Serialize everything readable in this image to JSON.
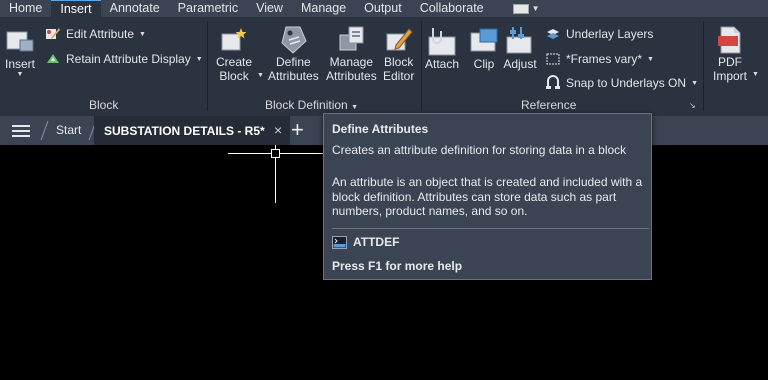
{
  "menu_tabs": [
    "Home",
    "Insert",
    "Annotate",
    "Parametric",
    "View",
    "Manage",
    "Output",
    "Collaborate"
  ],
  "active_tab": "Insert",
  "ribbon": {
    "block_panel": {
      "title": "Block",
      "insert_label": "Insert",
      "edit_attribute": "Edit Attribute",
      "retain_attribute_display": "Retain Attribute Display"
    },
    "block_definition_panel": {
      "title": "Block Definition",
      "create_block": [
        "Create",
        "Block"
      ],
      "define_attributes": [
        "Define",
        "Attributes"
      ],
      "manage_attributes": [
        "Manage",
        "Attributes"
      ],
      "block_editor": [
        "Block",
        "Editor"
      ]
    },
    "reference_panel": {
      "title": "Reference",
      "attach": "Attach",
      "clip": "Clip",
      "adjust": "Adjust",
      "underlay_layers": "Underlay Layers",
      "frames_vary": "*Frames vary*",
      "snap_to_underlays": "Snap to Underlays ON"
    },
    "pdf_import": [
      "PDF",
      "Import"
    ]
  },
  "file_tabs": {
    "start": "Start",
    "active_file": "SUBSTATION DETAILS - R5*",
    "close_glyph": "×",
    "new_tab_glyph": "+"
  },
  "tooltip": {
    "title": "Define Attributes",
    "description": "Creates an attribute definition for storing data in a block",
    "body": "An attribute is an object that is created and included with a block definition. Attributes can store data such as part numbers, product names, and so on.",
    "command": "ATTDEF",
    "help": "Press F1 for more help"
  },
  "colors": {
    "ribbon_bg": "#2b3240",
    "tab_bg": "#3b4453",
    "accent": "#58a8e8",
    "canvas": "#000000",
    "pdf_red": "#d64545"
  }
}
